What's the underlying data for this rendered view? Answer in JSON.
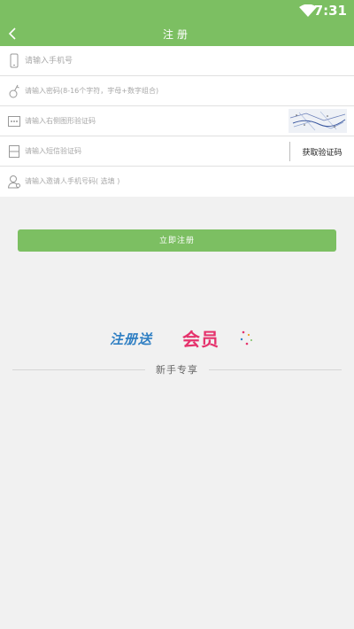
{
  "status_bar": {
    "time": "7:31",
    "wifi_icon": "wifi-icon"
  },
  "header": {
    "title": "注册",
    "back_icon": "chevron-left-icon"
  },
  "form": {
    "phone": {
      "placeholder": "请输入手机号",
      "icon": "phone-icon"
    },
    "password": {
      "placeholder": "请输入密码(8-16个字符，字母+数字组合)",
      "icon": "key-icon"
    },
    "captcha": {
      "placeholder": "请输入右侧图形验证码",
      "icon": "abc-icon"
    },
    "sms": {
      "placeholder": "请输入短信验证码",
      "icon": "message-icon",
      "button_label": "获取验证码"
    },
    "inviter": {
      "placeholder": "请输入邀请人手机号码( 选填 )",
      "icon": "user-icon"
    }
  },
  "register_button": {
    "label": "立即注册"
  },
  "promo": {
    "text_blue": "注册送",
    "text_pink": "会员"
  },
  "divider_label": "新手专享",
  "colors": {
    "primary": "#7cbf62",
    "promo_blue": "#2f7fc3",
    "promo_pink": "#e5326c"
  }
}
